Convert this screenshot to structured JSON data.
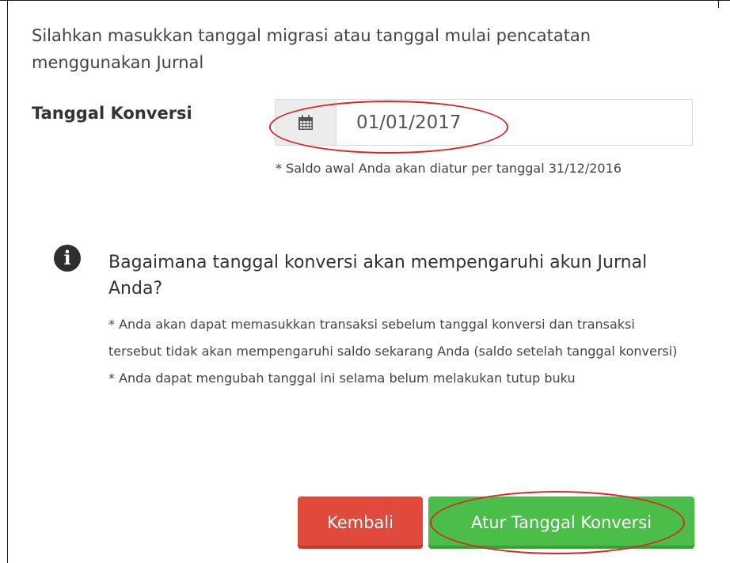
{
  "intro_text": "Silahkan masukkan tanggal migrasi atau tanggal mulai pencatatan menggunakan Jurnal",
  "conversion_date": {
    "label": "Tanggal Konversi",
    "value": "01/01/2017",
    "hint": "* Saldo awal Anda akan diatur per tanggal 31/12/2016"
  },
  "info": {
    "title": "Bagaimana tanggal konversi akan mempengaruhi akun Jurnal Anda?",
    "note_1": "* Anda akan dapat memasukkan transaksi sebelum tanggal konversi dan transaksi tersebut tidak akan mempengaruhi saldo sekarang Anda (saldo setelah tanggal konversi)",
    "note_2": "* Anda dapat mengubah tanggal ini selama belum melakukan tutup buku"
  },
  "buttons": {
    "back_label": "Kembali",
    "submit_label": "Atur Tanggal Konversi"
  },
  "colors": {
    "back_button": "#e04a3d",
    "submit_button": "#4bbe49",
    "annotation": "#d62828"
  },
  "icons": {
    "date_addon": "calendar-icon",
    "info": "info-circle-icon"
  }
}
